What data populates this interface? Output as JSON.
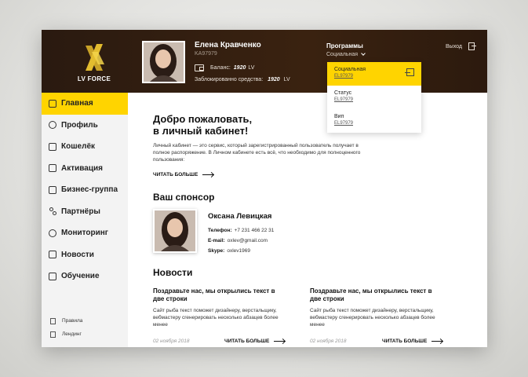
{
  "brand": {
    "logo_text": "LV FORCE"
  },
  "user": {
    "name": "Елена Кравченко",
    "id": "KA97979",
    "balance_label": "Баланс:",
    "balance_value": "1920",
    "balance_unit": "LV",
    "blocked_label": "Заблокированно средства:",
    "blocked_value": "1920",
    "blocked_unit": "LV"
  },
  "programs": {
    "title": "Программы",
    "selected": "Социальная",
    "items": [
      {
        "label": "Социальная",
        "code": "EL97979"
      },
      {
        "label": "Статус",
        "code": "EL97979"
      },
      {
        "label": "Вип",
        "code": "EL97979"
      }
    ]
  },
  "header": {
    "exit_label": "Выход"
  },
  "sidebar": {
    "items": [
      {
        "label": "Главная"
      },
      {
        "label": "Профиль"
      },
      {
        "label": "Кошелёк"
      },
      {
        "label": "Активация"
      },
      {
        "label": "Бизнес-группа"
      },
      {
        "label": "Партнёры"
      },
      {
        "label": "Мониторинг"
      },
      {
        "label": "Новости"
      },
      {
        "label": "Обучение"
      }
    ],
    "sub_items": [
      {
        "label": "Правила"
      },
      {
        "label": "Лендинг"
      }
    ]
  },
  "welcome": {
    "title_line1": "Добро пожаловать,",
    "title_line2": "в личный кабинет!",
    "text": "Личный кабинет — это сервис, который зарегистрированный пользователь получает в полное распоряжение. В Личном кабинете есть всё, что необходимо для полноценного пользования:",
    "read_more": "ЧИТАТЬ БОЛЬШЕ"
  },
  "sponsor": {
    "section_title": "Ваш спонсор",
    "name": "Оксана Левицкая",
    "phone_label": "Телефон:",
    "phone": "+7 231 466 22 31",
    "email_label": "E-mail:",
    "email": "oxlev@gmail.com",
    "skype_label": "Skype:",
    "skype": "oxlev1969"
  },
  "news": {
    "section_title": "Новости",
    "items": [
      {
        "title": "Поздравьте нас, мы открылись текст в две строки",
        "text": "Сайт рыба текст поможет дизайнеру, верстальщику, вебмастеру сгенерировать несколько абзацев более менее",
        "date": "02 ноября 2018",
        "read_more": "ЧИТАТЬ БОЛЬШЕ"
      },
      {
        "title": "Поздравьте нас, мы открылись текст в две строки",
        "text": "Сайт рыба текст поможет дизайнеру, верстальщику, вебмастеру сгенерировать несколько абзацев более менее",
        "date": "02 ноября 2018",
        "read_more": "ЧИТАТЬ БОЛЬШЕ"
      }
    ]
  },
  "colors": {
    "accent": "#ffd400",
    "header_bg": "#2f1d10",
    "sidebar_bg": "#f3f3f3"
  }
}
